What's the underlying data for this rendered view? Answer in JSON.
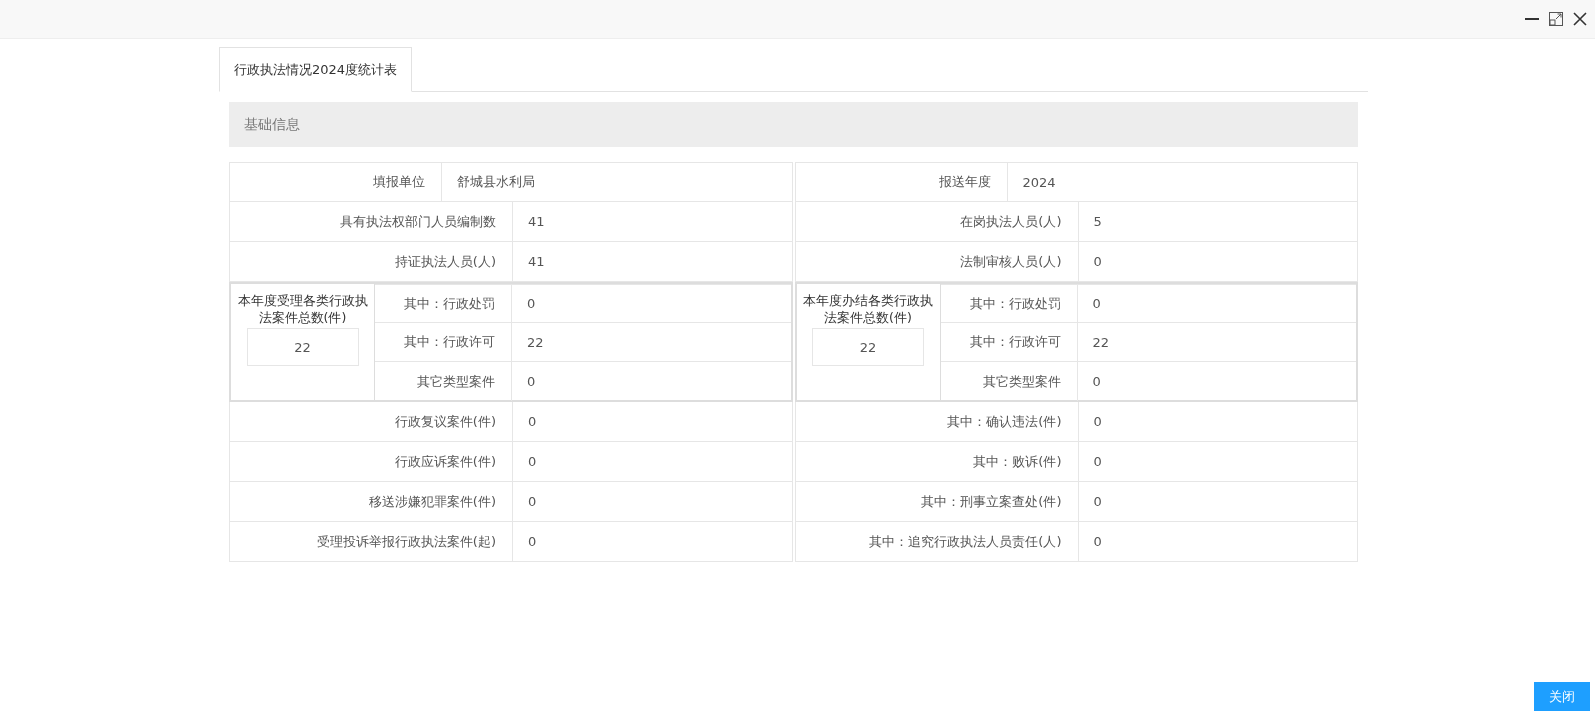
{
  "tabs": [
    {
      "label": "行政执法情况2024度统计表",
      "selected": true
    }
  ],
  "section": {
    "title": "基础信息"
  },
  "halves": [
    {
      "items": [
        {
          "kind": "wide",
          "label": "填报单位",
          "value": "舒城县水利局"
        },
        {
          "kind": "field",
          "label": "具有执法权部门人员编制数",
          "value": "41"
        },
        {
          "kind": "field",
          "label": "持证执法人员(人)",
          "value": "41"
        },
        {
          "kind": "group",
          "title": "本年度受理各类行政执法案件总数(件)",
          "total": "22",
          "items": [
            {
              "label": "其中：行政处罚",
              "value": "0"
            },
            {
              "label": "其中：行政许可",
              "value": "22"
            },
            {
              "label": "其它类型案件",
              "value": "0"
            }
          ]
        },
        {
          "kind": "field",
          "label": "行政复议案件(件)",
          "value": "0"
        },
        {
          "kind": "field",
          "label": "行政应诉案件(件)",
          "value": "0"
        },
        {
          "kind": "field",
          "label": "移送涉嫌犯罪案件(件)",
          "value": "0"
        },
        {
          "kind": "field",
          "label": "受理投诉举报行政执法案件(起)",
          "value": "0"
        }
      ]
    },
    {
      "items": [
        {
          "kind": "wide",
          "label": "报送年度",
          "value": "2024"
        },
        {
          "kind": "field",
          "label": "在岗执法人员(人)",
          "value": "5"
        },
        {
          "kind": "field",
          "label": "法制审核人员(人)",
          "value": "0"
        },
        {
          "kind": "group",
          "title": "本年度办结各类行政执法案件总数(件)",
          "total": "22",
          "items": [
            {
              "label": "其中：行政处罚",
              "value": "0"
            },
            {
              "label": "其中：行政许可",
              "value": "22"
            },
            {
              "label": "其它类型案件",
              "value": "0"
            }
          ]
        },
        {
          "kind": "field",
          "label": "其中：确认违法(件)",
          "value": "0"
        },
        {
          "kind": "field",
          "label": "其中：败诉(件)",
          "value": "0"
        },
        {
          "kind": "field",
          "label": "其中：刑事立案查处(件)",
          "value": "0"
        },
        {
          "kind": "field",
          "label": "其中：追究行政执法人员责任(人)",
          "value": "0"
        }
      ]
    }
  ],
  "buttons": [
    {
      "label": "关闭"
    }
  ]
}
